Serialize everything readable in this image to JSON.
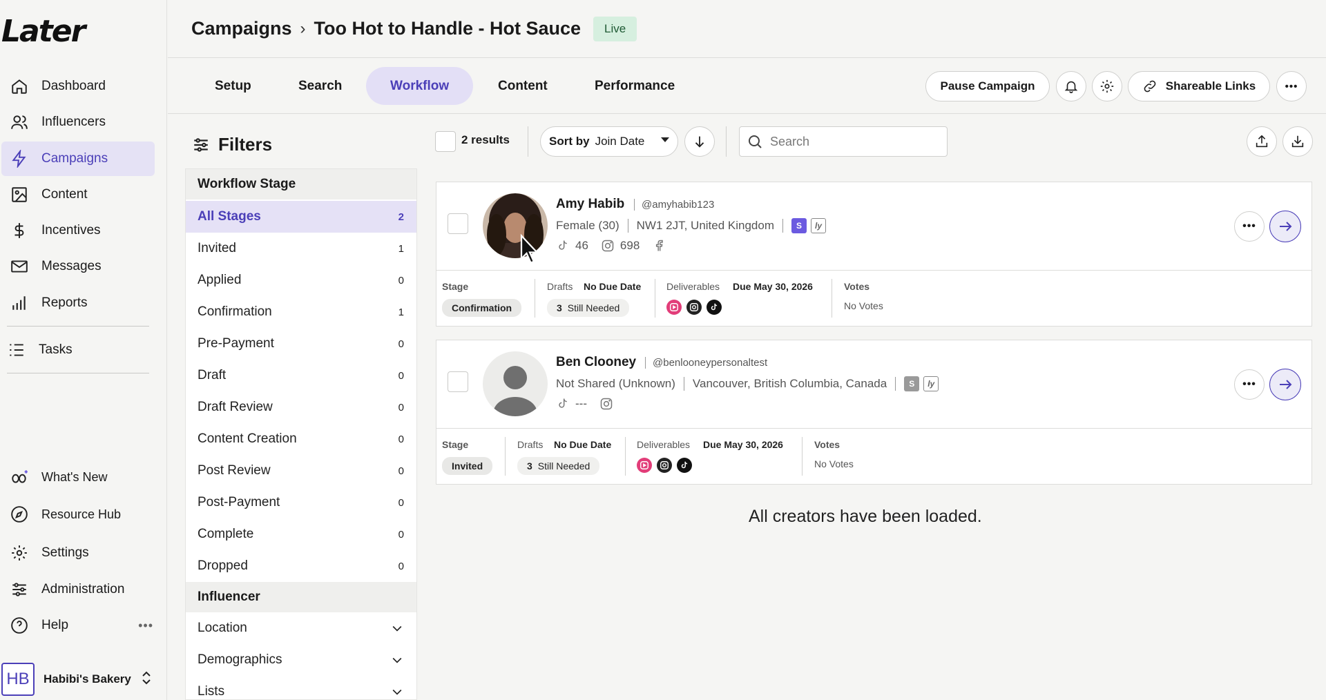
{
  "app": {
    "logo": "Later"
  },
  "sidebar": {
    "items": [
      {
        "label": "Dashboard"
      },
      {
        "label": "Influencers"
      },
      {
        "label": "Campaigns"
      },
      {
        "label": "Content"
      },
      {
        "label": "Incentives"
      },
      {
        "label": "Messages"
      },
      {
        "label": "Reports"
      },
      {
        "label": "Tasks"
      }
    ],
    "bottom": [
      {
        "label": "What's New"
      },
      {
        "label": "Resource Hub"
      },
      {
        "label": "Settings"
      },
      {
        "label": "Administration"
      },
      {
        "label": "Help"
      }
    ],
    "account": {
      "initials": "HB",
      "name": "Habibi's Bakery"
    }
  },
  "header": {
    "breadcrumb_root": "Campaigns",
    "campaign_name": "Too Hot to Handle - Hot Sauce",
    "status": "Live"
  },
  "tabs": [
    "Setup",
    "Search",
    "Workflow",
    "Content",
    "Performance"
  ],
  "active_tab": "Workflow",
  "actions": {
    "pause": "Pause Campaign",
    "shareable": "Shareable Links"
  },
  "filters": {
    "title": "Filters",
    "workflow_section": "Workflow Stage",
    "stages": [
      {
        "label": "All Stages",
        "count": "2"
      },
      {
        "label": "Invited",
        "count": "1"
      },
      {
        "label": "Applied",
        "count": "0"
      },
      {
        "label": "Confirmation",
        "count": "1"
      },
      {
        "label": "Pre-Payment",
        "count": "0"
      },
      {
        "label": "Draft",
        "count": "0"
      },
      {
        "label": "Draft Review",
        "count": "0"
      },
      {
        "label": "Content Creation",
        "count": "0"
      },
      {
        "label": "Post Review",
        "count": "0"
      },
      {
        "label": "Post-Payment",
        "count": "0"
      },
      {
        "label": "Complete",
        "count": "0"
      },
      {
        "label": "Dropped",
        "count": "0"
      }
    ],
    "influencer_section": "Influencer",
    "influencer_filters": [
      "Location",
      "Demographics",
      "Lists"
    ]
  },
  "toolbar": {
    "results": "2 results",
    "sort_prefix": "Sort by",
    "sort_value": "Join Date",
    "search_placeholder": "Search"
  },
  "creators": [
    {
      "name": "Amy Habib",
      "handle": "@amyhabib123",
      "demographic": "Female (30)",
      "location": "NW1 2JT, United Kingdom",
      "tiktok": "46",
      "instagram": "698",
      "stage_label": "Stage",
      "stage": "Confirmation",
      "drafts_label": "Drafts",
      "drafts_due": "No Due Date",
      "still_count": "3",
      "still_text": "Still Needed",
      "deliverables_label": "Deliverables",
      "deliverables_due": "Due May 30, 2026",
      "votes_label": "Votes",
      "votes": "No Votes"
    },
    {
      "name": "Ben Clooney",
      "handle": "@benlooneypersonaltest",
      "demographic": "Not Shared (Unknown)",
      "location": "Vancouver, British Columbia, Canada",
      "tiktok": "---",
      "instagram": "",
      "stage_label": "Stage",
      "stage": "Invited",
      "drafts_label": "Drafts",
      "drafts_due": "No Due Date",
      "still_count": "3",
      "still_text": "Still Needed",
      "deliverables_label": "Deliverables",
      "deliverables_due": "Due May 30, 2026",
      "votes_label": "Votes",
      "votes": "No Votes"
    }
  ],
  "footer_message": "All creators have been loaded.",
  "colors": {
    "accent": "#4b3fb8",
    "accent_bg": "#e5e1f6",
    "live_bg": "#d6efdf"
  }
}
